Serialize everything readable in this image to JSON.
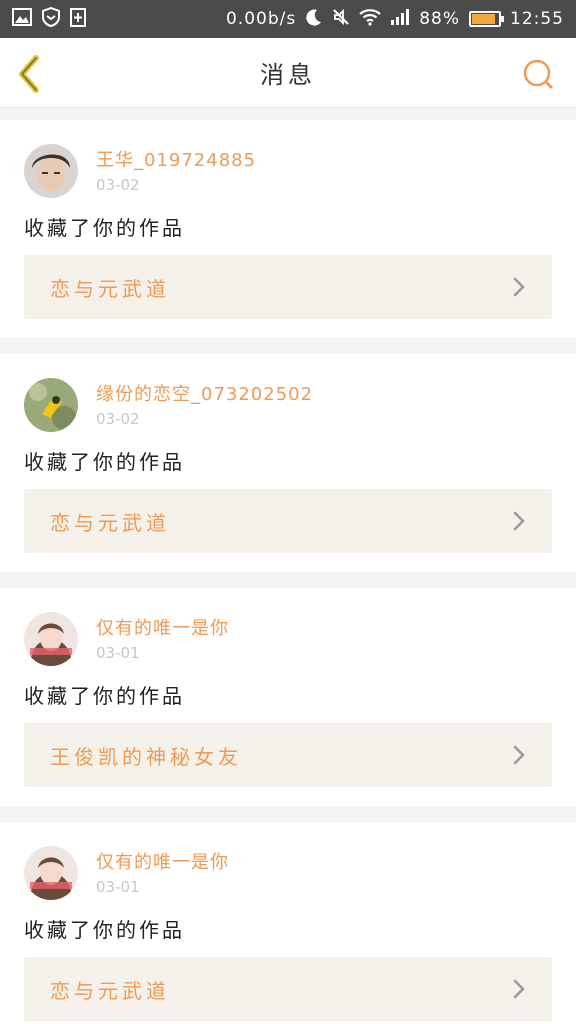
{
  "status_bar": {
    "speed": "0.00b/s",
    "battery": "88%",
    "battery_level": 0.88,
    "time": "12:55"
  },
  "header": {
    "title": "消息",
    "back_icon": "chevron-left-icon",
    "search_icon": "search-icon"
  },
  "colors": {
    "accent": "#ef9a55",
    "back_icon": "#e6c63a"
  },
  "notifications": [
    {
      "username": "王华_019724885",
      "date": "03-02",
      "action": "收藏了你的作品",
      "work_title": "恋与元武道"
    },
    {
      "username": "缘份的恋空_073202502",
      "date": "03-02",
      "action": "收藏了你的作品",
      "work_title": "恋与元武道"
    },
    {
      "username": "仅有的唯一是你",
      "date": "03-01",
      "action": "收藏了你的作品",
      "work_title": "王俊凯的神秘女友"
    },
    {
      "username": "仅有的唯一是你",
      "date": "03-01",
      "action": "收藏了你的作品",
      "work_title": "恋与元武道"
    }
  ]
}
